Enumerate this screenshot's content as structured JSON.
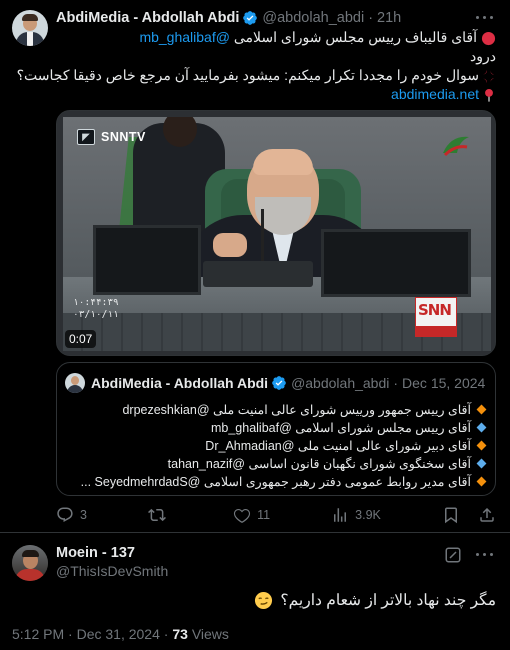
{
  "tweet": {
    "author_name": "AbdiMedia - Abdollah Abdi",
    "handle": "@abdolah_abdi",
    "separator": "·",
    "time": "21h",
    "lines": [
      {
        "emoji": "red-circle",
        "pre": "آقای قالیباف رییس مجلس شورای اسلامی ",
        "mention": "@mb_ghalibaf"
      },
      {
        "text": "درود"
      },
      {
        "emoji": "anger-symbol",
        "text": "سوال خودم را مجددا تکرار میکنم: میشود بفرمایید آن مرجع خاص دقیقا کجاست؟"
      },
      {
        "emoji": "round-pushpin",
        "link": "abdimedia.net"
      }
    ],
    "video": {
      "channel_label": "SNNTV",
      "badge": "SNN",
      "timestamp_line1": "۱۰:۴۴:۳۹",
      "timestamp_line2": "۰۳/۱۰/۱۱",
      "duration": "0:07"
    },
    "quote": {
      "author_name": "AbdiMedia - Abdollah Abdi",
      "handle": "@abdolah_abdi",
      "separator": "·",
      "date": "Dec 15, 2024",
      "lines": [
        {
          "bullet": "orange",
          "text": "آقای رییس جمهور ورییس شورای عالی امنیت ملی ",
          "mention": "@drpezeshkian"
        },
        {
          "bullet": "blue",
          "text": "آقای رییس مجلس شورای اسلامی ",
          "mention": "@mb_ghalibaf"
        },
        {
          "bullet": "orange",
          "text": "آقای دبیر شورای عالی امنیت ملی ",
          "mention": "@Dr_Ahmadian"
        },
        {
          "bullet": "blue",
          "text": "آقای سخنگوی شورای نگهبان قانون اساسی ",
          "mention": "@tahan_nazif"
        },
        {
          "bullet": "orange",
          "text": "آقای مدیر روابط عمومی دفتر رهبر جمهوری اسلامی ",
          "mention": "@SeyedmehrdadS",
          "suffix": " ..."
        }
      ]
    },
    "actions": {
      "replies": "3",
      "reposts": "",
      "likes": "11",
      "views": "3.9K"
    }
  },
  "reply": {
    "author_name": "Moein - 137",
    "handle": "@ThisIsDevSmith",
    "text": "مگر چند نهاد بالاتر از شعام داریم؟",
    "emoji": "smirking-face",
    "time": "5:12 PM",
    "separator": "·",
    "date": "Dec 31, 2024",
    "views_count": "73",
    "views_label": "Views"
  },
  "colors": {
    "background": "#000000",
    "text": "#e7e9ea",
    "muted": "#71767b",
    "link": "#1d9bf0",
    "border": "#2f3336",
    "verified": "#1d9bf0"
  }
}
